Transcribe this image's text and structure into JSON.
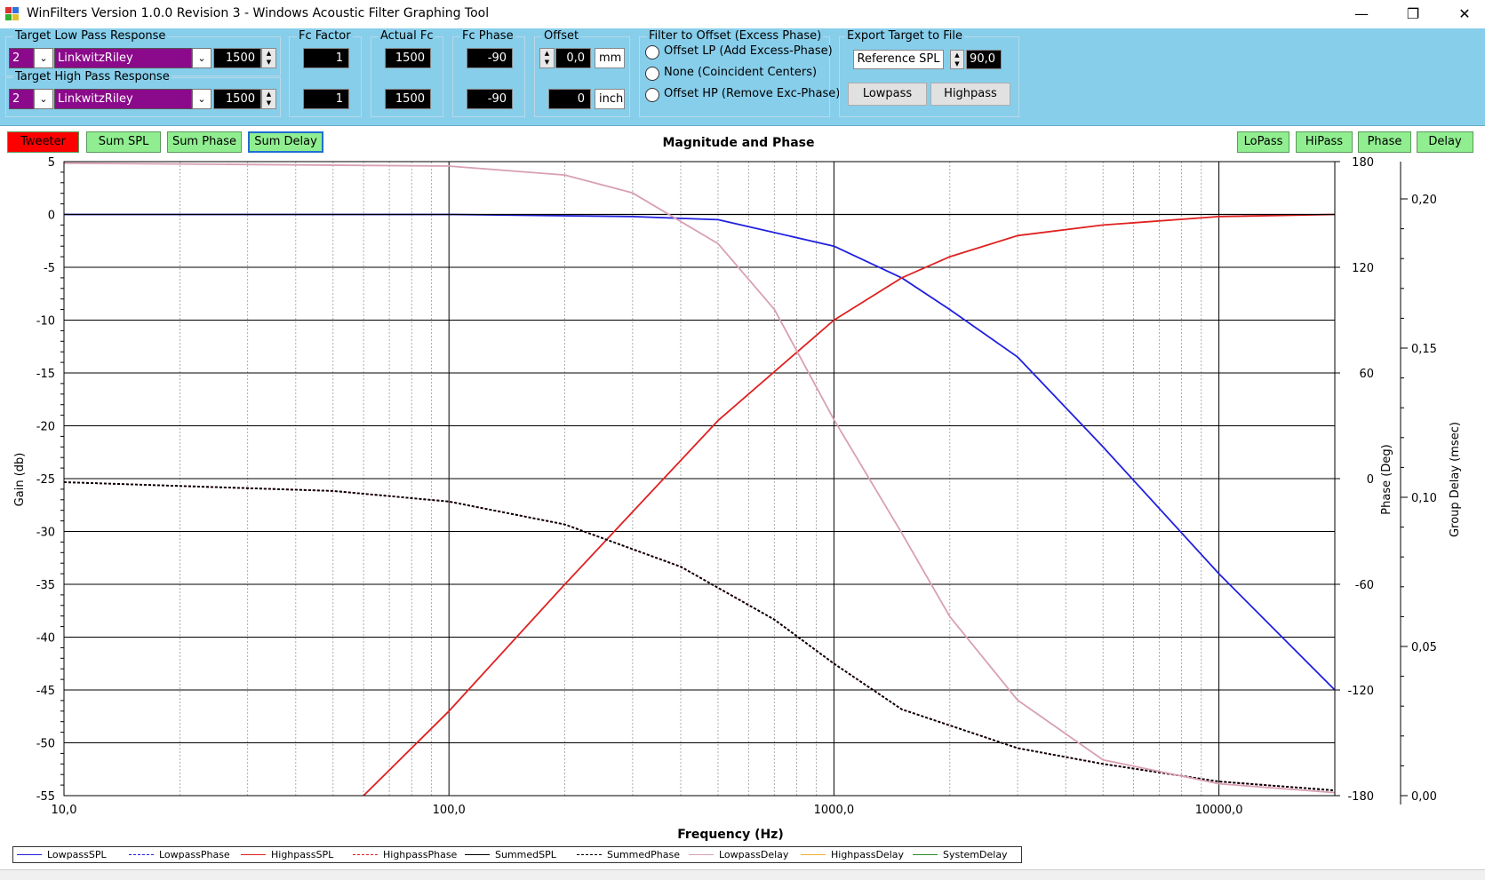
{
  "window": {
    "title": "WinFilters Version 1.0.0 Revision 3 - Windows Acoustic Filter Graphing Tool",
    "minimize_glyph": "—",
    "restore_glyph": "❐",
    "close_glyph": "✕"
  },
  "lowpass": {
    "group_label": "Target Low Pass Response",
    "order": "2",
    "type": "LinkwitzRiley",
    "freq": "1500",
    "fc_factor": "1",
    "actual_fc": "1500",
    "fc_phase": "-90"
  },
  "highpass": {
    "group_label": "Target High Pass Response",
    "order": "2",
    "type": "LinkwitzRiley",
    "freq": "1500",
    "fc_factor": "1",
    "actual_fc": "1500",
    "fc_phase": "-90"
  },
  "labels": {
    "fc_factor": "Fc Factor",
    "actual_fc": "Actual Fc",
    "fc_phase": "Fc Phase",
    "offset": "Offset"
  },
  "offset": {
    "mm_value": "0,0",
    "mm_unit": "mm",
    "inch_value": "0",
    "inch_unit": "inch"
  },
  "filter_offset": {
    "group_label": "Filter to Offset (Excess Phase)",
    "options": [
      "Offset LP (Add Excess-Phase)",
      "None (Coincident Centers)",
      "Offset HP (Remove Exc-Phase)"
    ]
  },
  "export": {
    "group_label": "Export Target to File",
    "ref_label": "Reference SPL",
    "ref_value": "90,0",
    "lowpass_button": "Lowpass",
    "highpass_button": "Highpass"
  },
  "toggles_left": [
    "Tweeter",
    "Sum SPL",
    "Sum Phase",
    "Sum Delay"
  ],
  "toggles_right": [
    "LoPass",
    "HiPass",
    "Phase",
    "Delay"
  ],
  "colors": {
    "lowpass": "#2020e0",
    "highpass": "#e02020",
    "delay": "#d8a0b0",
    "summed": "#000000",
    "toggle_on": "#90ee90",
    "toggle_red": "#ff0000",
    "panel": "#87ceeb"
  },
  "chart_data": {
    "type": "line",
    "title": "Magnitude and Phase",
    "xlabel": "Frequency (Hz)",
    "ylabel": "Gain (db)",
    "y2label": "Phase (Deg)",
    "y3label": "Group Delay (msec)",
    "xscale": "log",
    "xlim": [
      10,
      20000
    ],
    "ylim": [
      -55,
      5
    ],
    "y2lim": [
      -180,
      180
    ],
    "y3lim": [
      0,
      0.2125
    ],
    "x_ticks": [
      "10,0",
      "100,0",
      "1000,0",
      "10000,0"
    ],
    "y_ticks": [
      "5",
      "0",
      "-5",
      "-10",
      "-15",
      "-20",
      "-25",
      "-30",
      "-35",
      "-40",
      "-45",
      "-50",
      "-55"
    ],
    "y2_ticks": [
      "180",
      "120",
      "60",
      "0",
      "-60",
      "-120",
      "-180"
    ],
    "y3_ticks": [
      "0,20",
      "0,15",
      "0,10",
      "0,05",
      "0,00"
    ],
    "legend_position": "bottom",
    "series": [
      {
        "name": "LowpassSPL",
        "axis": "gain",
        "x": [
          10,
          100,
          300,
          500,
          1000,
          1500,
          2000,
          3000,
          5000,
          10000,
          20000
        ],
        "y": [
          0,
          0,
          -0.2,
          -0.5,
          -3,
          -6,
          -9,
          -13.5,
          -22,
          -34,
          -45
        ]
      },
      {
        "name": "LowpassPhase",
        "axis": "phase",
        "x": [
          10,
          50,
          100,
          200,
          400,
          700,
          1000,
          1500,
          3000,
          5000,
          10000,
          20000
        ],
        "y": [
          -2,
          -7,
          -13,
          -26,
          -50,
          -80,
          -105,
          -131,
          -153,
          -162,
          -172,
          -177
        ]
      },
      {
        "name": "HighpassSPL",
        "axis": "gain",
        "x": [
          60,
          100,
          200,
          500,
          1000,
          1500,
          2000,
          3000,
          5000,
          10000,
          20000
        ],
        "y": [
          -55,
          -47,
          -35,
          -19.5,
          -10,
          -6,
          -4,
          -2,
          -1,
          -0.2,
          0
        ]
      },
      {
        "name": "HighpassPhase",
        "axis": "phase",
        "x": [
          10,
          50,
          100,
          200,
          400,
          700,
          1000,
          1500,
          3000,
          5000,
          10000,
          20000
        ],
        "y": [
          -2,
          -7,
          -13,
          -26,
          -50,
          -80,
          -105,
          -131,
          -153,
          -162,
          -172,
          -177
        ]
      },
      {
        "name": "SummedSPL",
        "axis": "gain",
        "x": [
          10,
          20000
        ],
        "y": [
          0,
          0
        ]
      },
      {
        "name": "SummedPhase",
        "axis": "phase",
        "x": [
          10,
          50,
          100,
          200,
          400,
          700,
          1000,
          1500,
          3000,
          5000,
          10000,
          20000
        ],
        "y": [
          -2,
          -7,
          -13,
          -26,
          -50,
          -80,
          -105,
          -131,
          -153,
          -162,
          -172,
          -177
        ]
      },
      {
        "name": "LowpassDelay",
        "axis": "delay",
        "x": [
          10,
          100,
          200,
          300,
          500,
          700,
          1000,
          1500,
          2000,
          3000,
          5000,
          10000,
          20000
        ],
        "y": [
          0.212,
          0.211,
          0.208,
          0.202,
          0.185,
          0.163,
          0.126,
          0.088,
          0.06,
          0.032,
          0.012,
          0.004,
          0.001
        ]
      },
      {
        "name": "HighpassDelay",
        "axis": "delay",
        "x": [],
        "y": []
      },
      {
        "name": "SystemDelay",
        "axis": "delay",
        "x": [],
        "y": []
      }
    ]
  },
  "legend": [
    {
      "name": "LowpassSPL",
      "color": "#2020e0",
      "dash": "solid"
    },
    {
      "name": "LowpassPhase",
      "color": "#2020e0",
      "dash": "dashed"
    },
    {
      "name": "HighpassSPL",
      "color": "#e02020",
      "dash": "solid"
    },
    {
      "name": "HighpassPhase",
      "color": "#e02020",
      "dash": "dashed"
    },
    {
      "name": "SummedSPL",
      "color": "#000000",
      "dash": "solid"
    },
    {
      "name": "SummedPhase",
      "color": "#000000",
      "dash": "dashed"
    },
    {
      "name": "LowpassDelay",
      "color": "#d8a0b0",
      "dash": "solid"
    },
    {
      "name": "HighpassDelay",
      "color": "#f0b030",
      "dash": "solid"
    },
    {
      "name": "SystemDelay",
      "color": "#2e8b2e",
      "dash": "solid"
    }
  ]
}
